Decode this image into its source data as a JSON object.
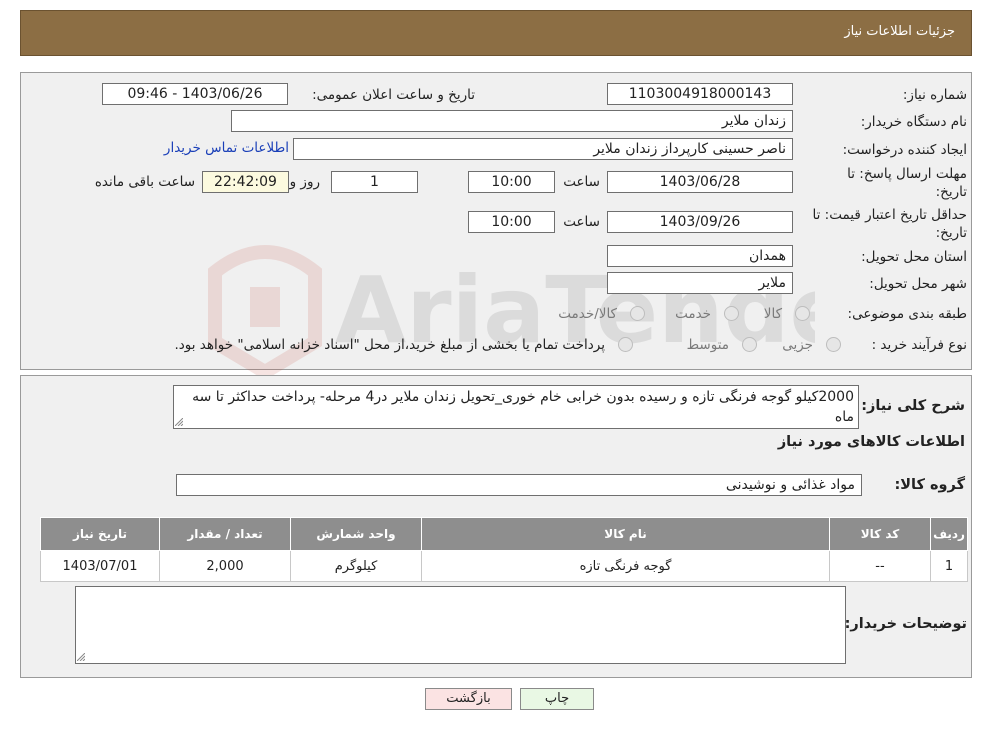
{
  "header": {
    "title": "جزئیات اطلاعات نیاز"
  },
  "form": {
    "need_number_label": "شماره نیاز:",
    "need_number": "1103004918000143",
    "announce_label": "تاریخ و ساعت اعلان عمومی:",
    "announce_value": "1403/06/26 - 09:46",
    "buyer_label": "نام دستگاه خریدار:",
    "buyer": "زندان ملایر",
    "creator_label": "ایجاد کننده درخواست:",
    "creator": "ناصر  حسینی کارپرداز زندان ملایر",
    "contact_link": "اطلاعات تماس خریدار",
    "deadline_label": "مهلت ارسال پاسخ: تا تاریخ:",
    "deadline_date": "1403/06/28",
    "time_label": "ساعت",
    "deadline_time": "10:00",
    "days_value": "1",
    "days_label": "روز و",
    "remaining_time": "22:42:09",
    "remaining_label": "ساعت باقی مانده",
    "validity_label": "حداقل تاریخ اعتبار قیمت: تا تاریخ:",
    "validity_date": "1403/09/26",
    "validity_time": "10:00",
    "province_label": "استان محل تحویل:",
    "province": "همدان",
    "city_label": "شهر محل تحویل:",
    "city": "ملایر",
    "category_label": "طبقه بندی موضوعی:",
    "category_options": [
      "کالا",
      "خدمت",
      "کالا/خدمت"
    ],
    "process_label": "نوع فرآیند خرید :",
    "process_options": [
      "جزیی",
      "متوسط"
    ],
    "process_note": "پرداخت تمام یا بخشی از مبلغ خرید،از محل \"اسناد خزانه اسلامی\" خواهد بود."
  },
  "details": {
    "description_label": "شرح کلی نیاز:",
    "description": "2000کیلو گوجه فرنگی تازه و رسیده بدون خرابی خام خوری_تحویل زندان ملایر در4 مرحله- پرداخت حداکثر تا سه ماه",
    "goods_info_title": "اطلاعات کالاهای مورد نیاز",
    "goods_group_label": "گروه کالا:",
    "goods_group": "مواد غذائی و نوشیدنی",
    "table": {
      "headers": [
        "ردیف",
        "کد کالا",
        "نام کالا",
        "واحد شمارش",
        "تعداد / مقدار",
        "تاریخ نیاز"
      ],
      "rows": [
        [
          "1",
          "--",
          "گوجه فرنگی تازه",
          "کیلوگرم",
          "2,000",
          "1403/07/01"
        ]
      ]
    },
    "buyer_notes_label": "توضیحات خریدار:",
    "buyer_notes": ""
  },
  "buttons": {
    "print": "چاپ",
    "back": "بازگشت"
  },
  "watermark": {
    "text": "AriaTender.neT"
  }
}
